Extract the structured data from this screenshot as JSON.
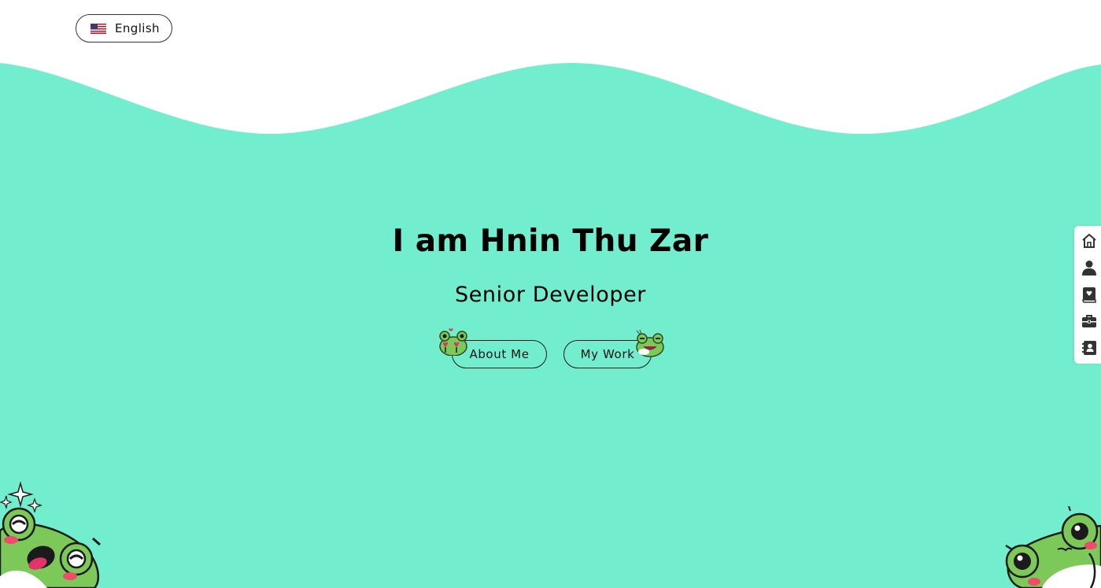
{
  "language_switcher": {
    "label": "English",
    "flag_icon": "us-flag-icon"
  },
  "hero": {
    "title": "I am Hnin Thu Zar",
    "subtitle": "Senior Developer"
  },
  "actions": {
    "about_label": "About Me",
    "work_label": "My Work"
  },
  "side_nav": {
    "items": [
      {
        "icon": "home-icon"
      },
      {
        "icon": "user-icon"
      },
      {
        "icon": "book-heart-icon"
      },
      {
        "icon": "briefcase-icon"
      },
      {
        "icon": "address-book-icon"
      }
    ]
  },
  "colors": {
    "background": "#72eecf",
    "wave": "#ffffff",
    "frog": "#7cc95a",
    "text": "#000000"
  }
}
